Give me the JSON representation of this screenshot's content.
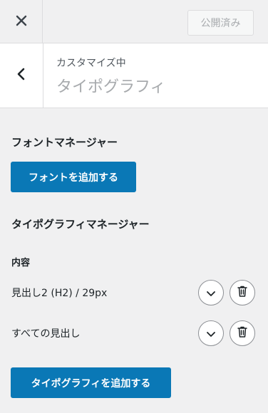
{
  "topbar": {
    "close_icon": "close-icon",
    "publish_label": "公開済み"
  },
  "header": {
    "breadcrumb": "カスタマイズ中",
    "title": "タイポグラフィ",
    "back_icon": "chevron-left-icon"
  },
  "font_manager": {
    "heading": "フォントマネージャー",
    "add_button": "フォントを追加する"
  },
  "typography_manager": {
    "heading": "タイポグラフィマネージャー",
    "content_label": "内容",
    "items": [
      {
        "label": "見出し2 (H2) / 29px",
        "expand_icon": "chevron-down-icon",
        "delete_icon": "trash-icon"
      },
      {
        "label": "すべての見出し",
        "expand_icon": "chevron-down-icon",
        "delete_icon": "trash-icon"
      }
    ],
    "add_button": "タイポグラフィを追加する"
  },
  "colors": {
    "accent": "#0a78b6",
    "background": "#f0f0f1"
  }
}
